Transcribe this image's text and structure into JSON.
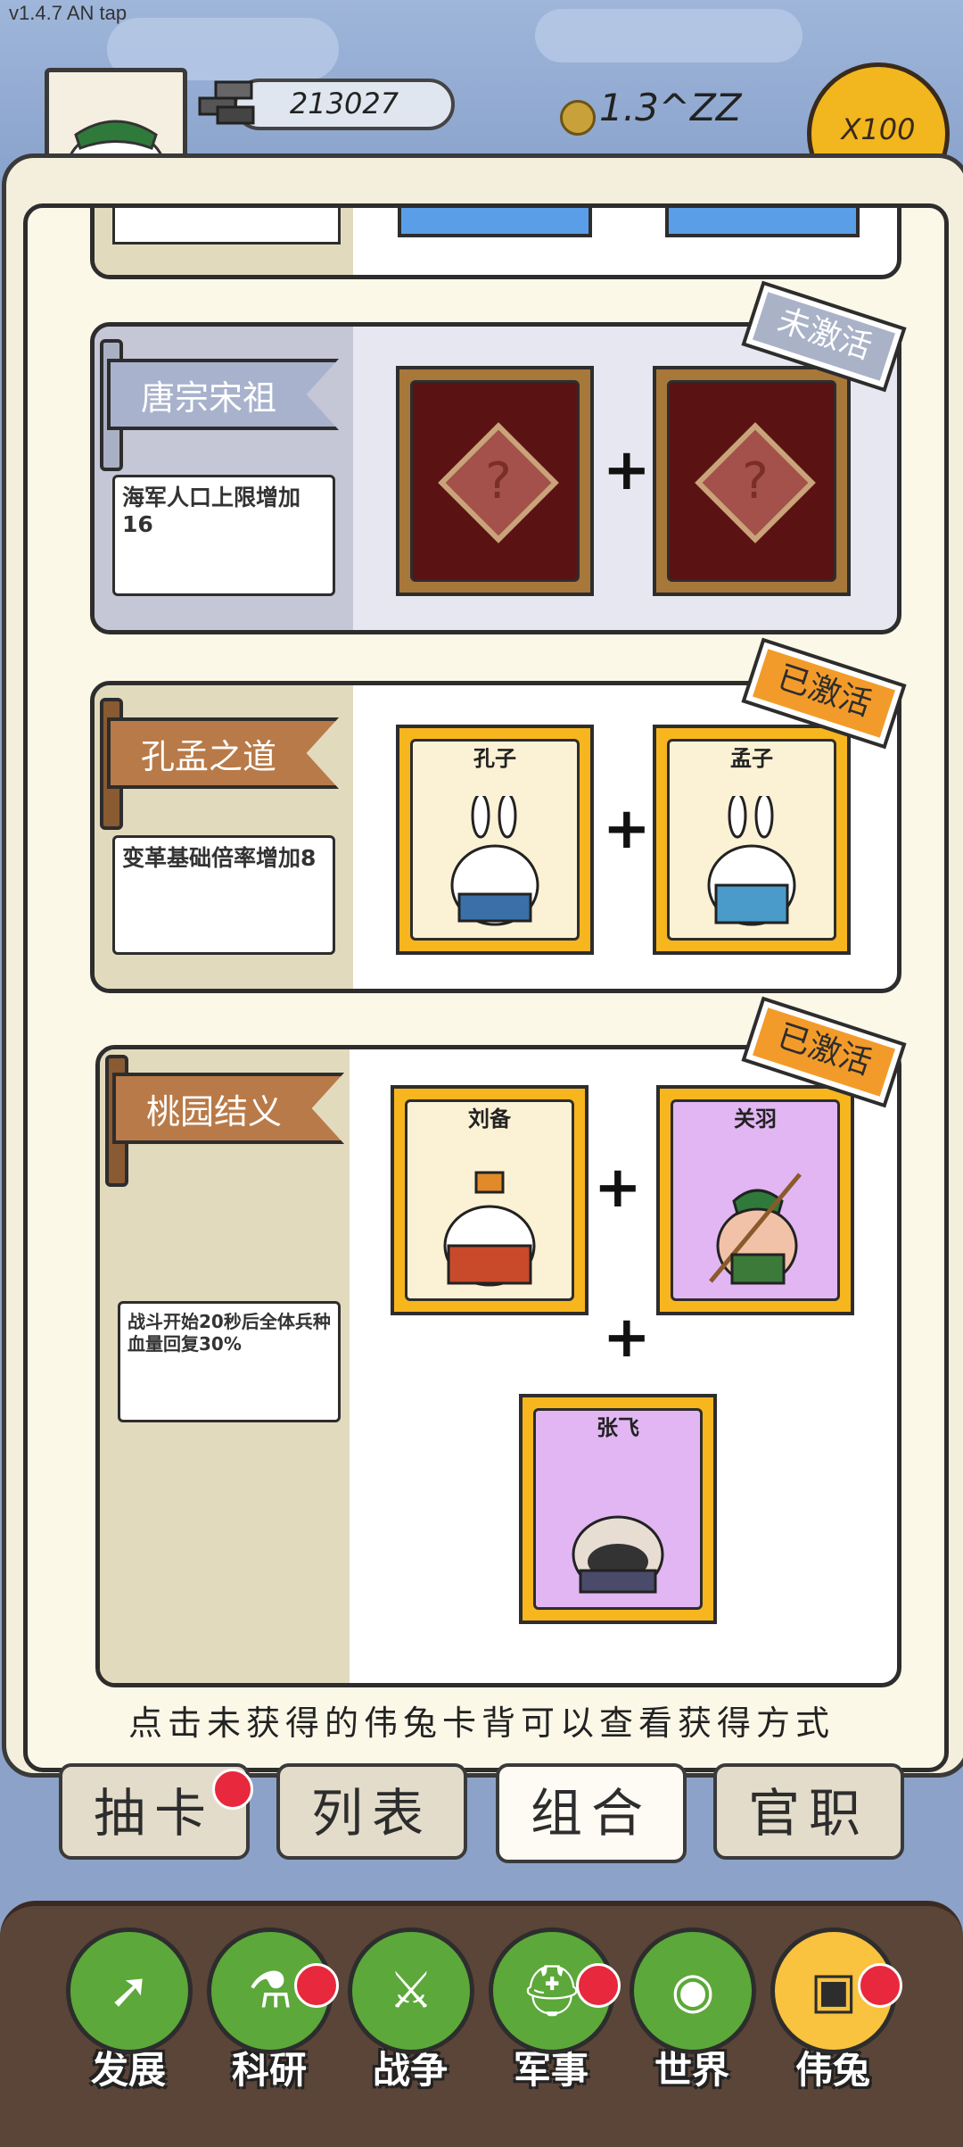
{
  "version": "v1.4.7 AN tap",
  "resources": {
    "stone": "213027",
    "gold": "1.3^ZZ",
    "multiplier": "X100"
  },
  "combos": [
    {
      "title": "唐宗宋祖",
      "status": "未激活",
      "description": "海军人口上限增加16",
      "cards": [
        {
          "name": "",
          "locked": true
        },
        {
          "name": "",
          "locked": true
        }
      ]
    },
    {
      "title": "孔孟之道",
      "status": "已激活",
      "description": "变革基础倍率增加8",
      "cards": [
        {
          "name": "孔子"
        },
        {
          "name": "孟子"
        }
      ]
    },
    {
      "title": "桃园结义",
      "status": "已激活",
      "description": "战斗开始20秒后全体兵种血量回复30%",
      "cards": [
        {
          "name": "刘备"
        },
        {
          "name": "关羽"
        },
        {
          "name": "张飞"
        }
      ]
    }
  ],
  "hint": "点击未获得的伟兔卡背可以查看获得方式",
  "tabs": [
    {
      "label": "抽卡",
      "badge": true
    },
    {
      "label": "列表",
      "badge": false
    },
    {
      "label": "组合",
      "badge": false,
      "active": true
    },
    {
      "label": "官职",
      "badge": false
    }
  ],
  "nav": [
    {
      "label": "发展",
      "icon": "arrow-up-icon",
      "badge": false
    },
    {
      "label": "科研",
      "icon": "flask-icon",
      "badge": true
    },
    {
      "label": "战争",
      "icon": "crossed-swords-icon",
      "badge": false
    },
    {
      "label": "军事",
      "icon": "helmet-icon",
      "badge": true
    },
    {
      "label": "世界",
      "icon": "globe-icon",
      "badge": false
    },
    {
      "label": "伟兔",
      "icon": "bunny-card-icon",
      "badge": true,
      "active": true
    }
  ],
  "colors": {
    "accent_active": "#f9c23f",
    "nav_green": "#5ca83a",
    "badge_red": "#e8283c",
    "stamp_orange": "#f39b2a",
    "stamp_gray": "#aab2c8"
  }
}
